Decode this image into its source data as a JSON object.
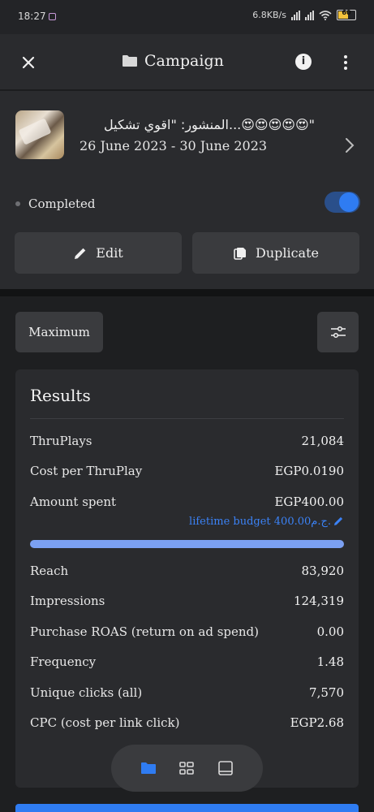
{
  "status_bar": {
    "time": "18:27",
    "net_speed": "6.8KB/s",
    "battery": "60"
  },
  "header": {
    "title": "Campaign"
  },
  "post": {
    "title": "المنشور: \"اقوي تشكيل...😍😍😍😍😍\"",
    "dates": "26 June 2023 - 30 June 2023"
  },
  "status": {
    "label": "Completed",
    "toggle_on": true
  },
  "actions": {
    "edit_label": "Edit",
    "duplicate_label": "Duplicate"
  },
  "filters": {
    "bid_label": "Maximum"
  },
  "results": {
    "title": "Results",
    "thruplays_label": "ThruPlays",
    "thruplays_value": "21,084",
    "cost_label": "Cost per ThruPlay",
    "cost_value": "EGP0.0190",
    "spent_label": "Amount spent",
    "spent_value": "EGP400.00",
    "budget_text": "lifetime budget 400.00ج.م.",
    "budget_progress": 1.0,
    "reach_label": "Reach",
    "reach_value": "83,920",
    "impressions_label": "Impressions",
    "impressions_value": "124,319",
    "roas_label": "Purchase ROAS (return on ad spend)",
    "roas_value": "0.00",
    "frequency_label": "Frequency",
    "frequency_value": "1.48",
    "unique_clicks_label": "Unique clicks (all)",
    "unique_clicks_value": "7,570",
    "cpc_label": "CPC (cost per link click)",
    "cpc_value": "EGP2.68"
  },
  "bottom_nav": {
    "items": [
      "folder-icon",
      "grid-icon",
      "ad-icon"
    ],
    "active": "folder-icon"
  },
  "colors": {
    "accent": "#2f7cf2",
    "progress": "#7ba0f2",
    "budget_link": "#3b82f6"
  }
}
